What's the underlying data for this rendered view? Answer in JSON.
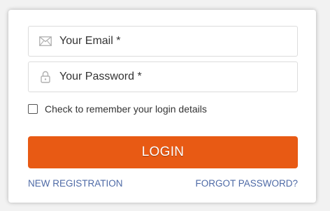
{
  "form": {
    "email": {
      "placeholder": "Your Email *",
      "value": "",
      "icon": "envelope-icon"
    },
    "password": {
      "placeholder": "Your Password *",
      "value": "",
      "icon": "lock-icon"
    },
    "remember": {
      "label": "Check to remember your login details",
      "checked": false
    },
    "login_label": "LOGIN",
    "new_registration_label": "NEW REGISTRATION",
    "forgot_password_label": "FORGOT PASSWORD?"
  },
  "colors": {
    "accent": "#e85a14",
    "link": "#4e6aa6",
    "icon": "#b0b0b0"
  }
}
